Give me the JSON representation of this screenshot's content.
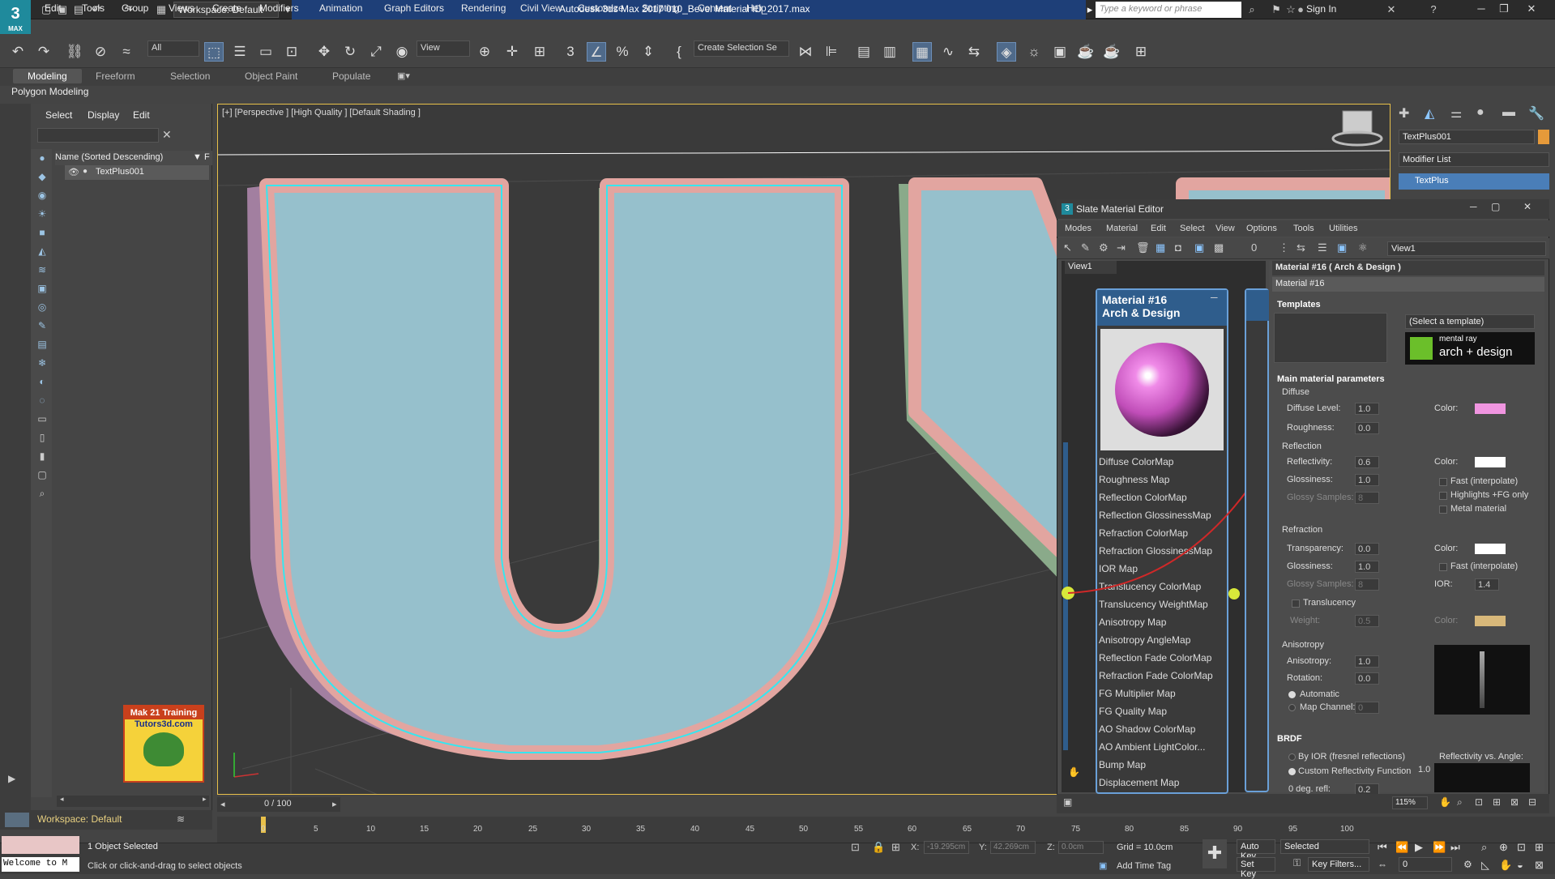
{
  "title_bar": {
    "workspace": "Workspace: Default",
    "app_title": "Autodesk 3ds Max 2017    010_Bevel Material ID_2017.max",
    "search_placeholder": "Type a keyword or phrase",
    "sign_in": "Sign In"
  },
  "menu": [
    "Edit",
    "Tools",
    "Group",
    "Views",
    "Create",
    "Modifiers",
    "Animation",
    "Graph Editors",
    "Rendering",
    "Civil View",
    "Customize",
    "Scripting",
    "Content",
    "Help"
  ],
  "toolbar": {
    "selection_filter": "All",
    "view_dropdown": "View",
    "create_selection_set": "Create Selection Se"
  },
  "ribbon": {
    "tabs": [
      "Modeling",
      "Freeform",
      "Selection",
      "Object Paint",
      "Populate"
    ],
    "active": "Modeling",
    "panel_label": "Polygon Modeling"
  },
  "scene_explorer": {
    "tabs": [
      "Select",
      "Display",
      "Edit"
    ],
    "column_header": "Name (Sorted Descending)",
    "column_header_suffix": "F",
    "items": [
      "TextPlus001"
    ]
  },
  "viewport": {
    "label": "[+] [Perspective ] [High Quality ] [Default Shading ]",
    "badge_line1": "Mak 21 Training",
    "badge_line2": "Tutors3d.com"
  },
  "command_panel": {
    "object_name": "TextPlus001",
    "modifier_list": "Modifier List",
    "stack_item": "TextPlus"
  },
  "slate_editor": {
    "title": "Slate Material Editor",
    "menu": [
      "Modes",
      "Material",
      "Edit",
      "Select",
      "View",
      "Options",
      "Tools",
      "Utilities"
    ],
    "view_dropdown": "View1",
    "view_tab": "View1",
    "node": {
      "title_line1": "Material #16",
      "title_line2": "Arch & Design",
      "slots": [
        "Diffuse ColorMap",
        "Roughness Map",
        "Reflection ColorMap",
        "Reflection GlossinessMap",
        "Refraction ColorMap",
        "Refraction GlossinessMap",
        "IOR Map",
        "Translucency ColorMap",
        "Translucency WeightMap",
        "Anisotropy Map",
        "Anisotropy AngleMap",
        "Reflection Fade ColorMap",
        "Refraction Fade ColorMap",
        "FG Multiplier Map",
        "FG Quality Map",
        "AO Shadow ColorMap",
        "AO Ambient LightColor...",
        "Bump Map",
        "Displacement Map"
      ]
    },
    "params": {
      "header": "Material #16  ( Arch & Design )",
      "material_name": "Material #16",
      "templates_title": "Templates",
      "template_select": "(Select a template)",
      "mr_line1": "mental ray",
      "mr_line2": "arch + design",
      "main_title": "Main material parameters",
      "diffuse": {
        "title": "Diffuse",
        "level_label": "Diffuse Level:",
        "level": "1.0",
        "rough_label": "Roughness:",
        "rough": "0.0",
        "color_label": "Color:",
        "color": "#f095e0"
      },
      "reflection": {
        "title": "Reflection",
        "refl_label": "Reflectivity:",
        "refl": "0.6",
        "gloss_label": "Glossiness:",
        "gloss": "1.0",
        "samples_label": "Glossy Samples:",
        "samples": "8",
        "color_label": "Color:",
        "color": "#ffffff",
        "opt1": "Fast (interpolate)",
        "opt2": "Highlights +FG only",
        "opt3": "Metal material"
      },
      "refraction": {
        "title": "Refraction",
        "trans_label": "Transparency:",
        "trans": "0.0",
        "gloss_label": "Glossiness:",
        "gloss": "1.0",
        "samples_label": "Glossy Samples:",
        "samples": "8",
        "color_label": "Color:",
        "color": "#ffffff",
        "opt1": "Fast (interpolate)",
        "ior_label": "IOR:",
        "ior": "1.4",
        "transl_label": "Translucency",
        "weight_label": "Weight:",
        "weight": "0.5",
        "transl_color_label": "Color:",
        "transl_color": "#d8b87a"
      },
      "anisotropy": {
        "title": "Anisotropy",
        "aniso_label": "Anisotropy:",
        "aniso": "1.0",
        "rot_label": "Rotation:",
        "rot": "0.0",
        "auto": "Automatic",
        "map_channel_label": "Map Channel:",
        "map_channel": "0"
      },
      "brdf": {
        "title": "BRDF",
        "opt1": "By IOR (fresnel reflections)",
        "opt2": "Custom Reflectivity Function",
        "right_label": "Reflectivity vs. Angle:",
        "right_value": "1.0",
        "deg_label": "0 deg. refl:",
        "deg_value": "0.2"
      }
    },
    "zoom": "115%"
  },
  "timeline": {
    "range": "0 / 100",
    "ticks": [
      "0",
      "5",
      "10",
      "15",
      "20",
      "25",
      "30",
      "35",
      "40",
      "45",
      "50",
      "55",
      "60",
      "65",
      "70",
      "75",
      "80",
      "85",
      "90",
      "95",
      "100"
    ]
  },
  "status": {
    "workspace": "Workspace: Default",
    "script_box": "Welcome to M",
    "selected": "1 Object Selected",
    "hint": "Click or click-and-drag to select objects",
    "x_label": "X:",
    "x": "-19.295cm",
    "y_label": "Y:",
    "y": "42.269cm",
    "z_label": "Z:",
    "z": "0.0cm",
    "grid": "Grid = 10.0cm",
    "add_time_tag": "Add Time Tag",
    "auto_key": "Auto Key",
    "set_key": "Set Key",
    "selected_dd": "Selected",
    "key_filters": "Key Filters...",
    "frame": "0"
  }
}
